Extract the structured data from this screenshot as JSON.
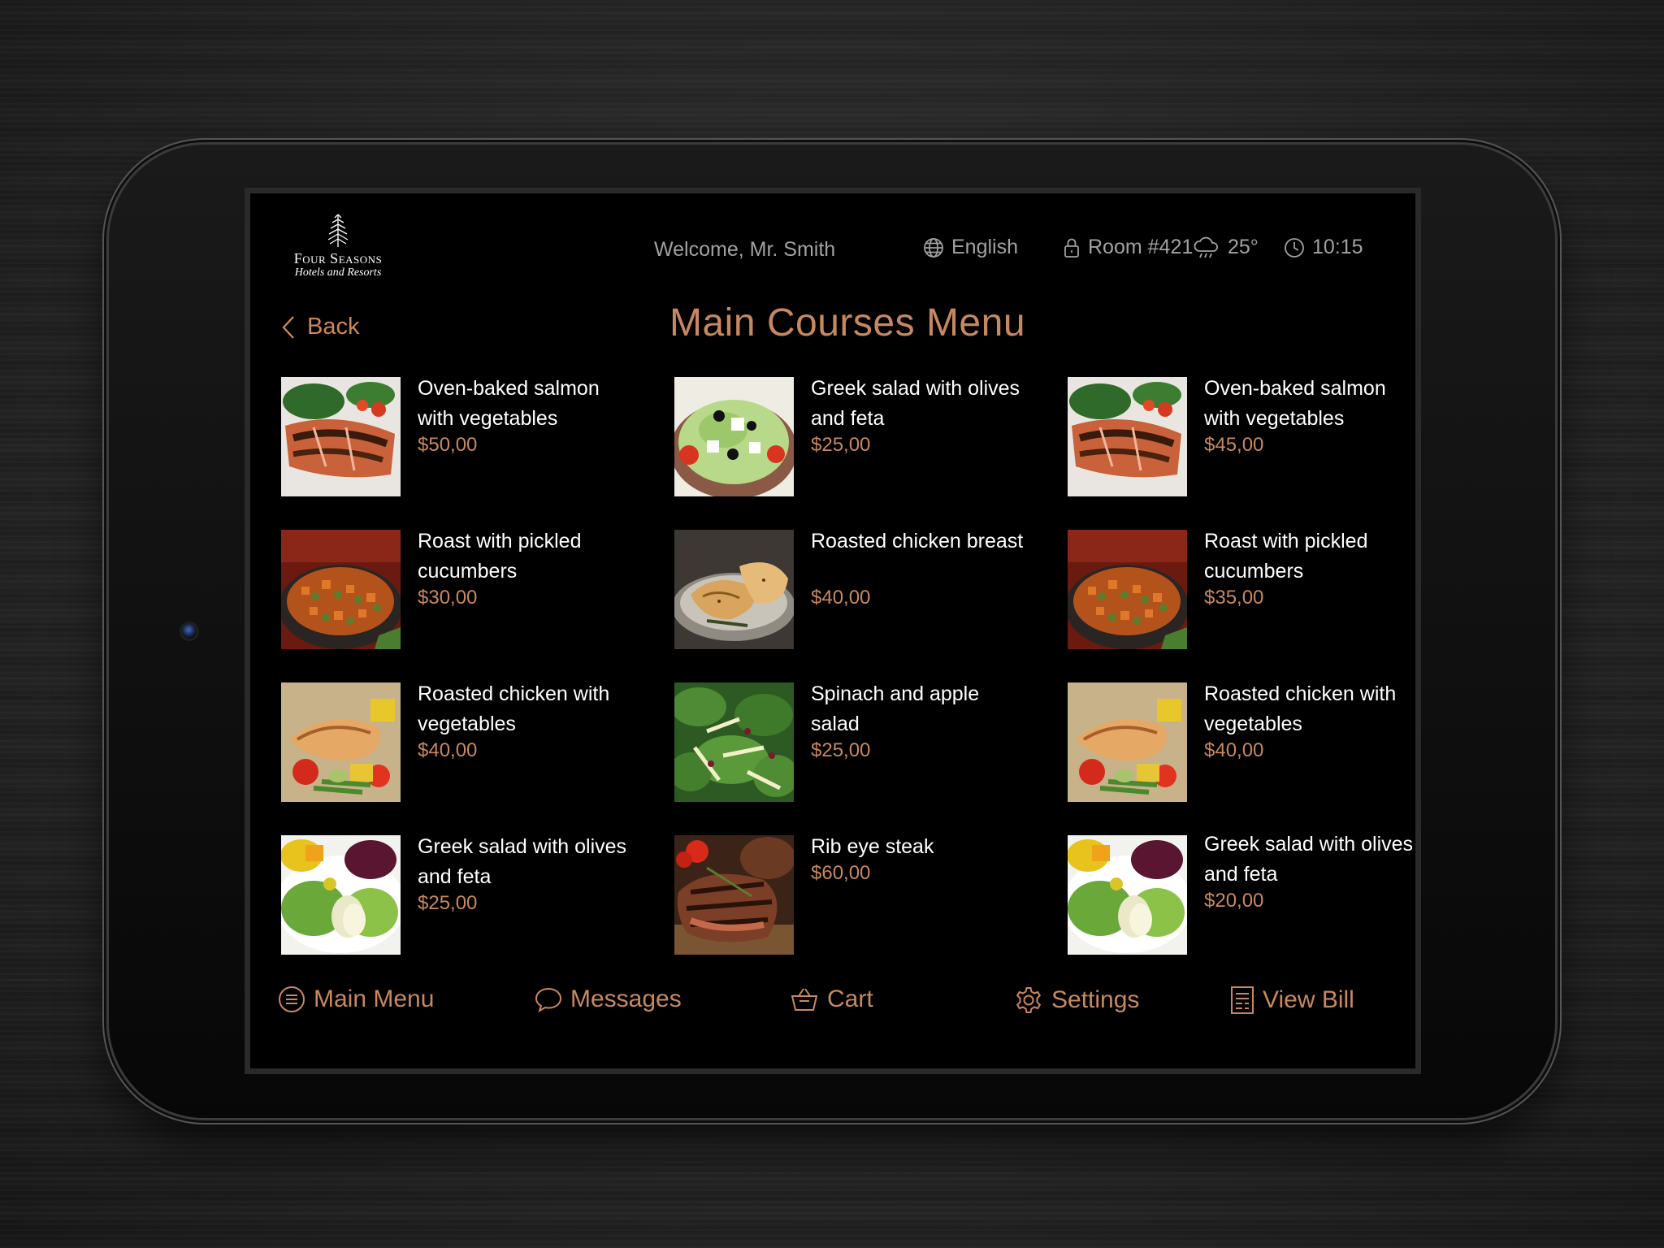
{
  "header": {
    "logo_brand": "Four Seasons",
    "logo_sub": "Hotels and Resorts",
    "welcome": "Welcome, Mr. Smith",
    "language": "English",
    "room": "Room #421",
    "temperature": "25°",
    "time": "10:15"
  },
  "back_label": "Back",
  "page_title": "Main Courses Menu",
  "menu_items": [
    {
      "name": "Oven-baked salmon with vegetables",
      "price": "$50,00",
      "image": "salmon"
    },
    {
      "name": "Greek salad with olives and feta",
      "price": "$25,00",
      "image": "greek-bowl"
    },
    {
      "name": "Oven-baked salmon with vegetables",
      "price": "$45,00",
      "image": "salmon"
    },
    {
      "name": "Roast with pickled cucumbers",
      "price": "$30,00",
      "image": "roast"
    },
    {
      "name": "Roasted chicken breast",
      "price": "$40,00",
      "image": "chicken-breast"
    },
    {
      "name": "Roast with pickled cucumbers",
      "price": "$35,00",
      "image": "roast"
    },
    {
      "name": "Roasted chicken with vegetables",
      "price": "$40,00",
      "image": "chicken-veg"
    },
    {
      "name": "Spinach and apple salad",
      "price": "$25,00",
      "image": "spinach"
    },
    {
      "name": "Roasted chicken with vegetables",
      "price": "$40,00",
      "image": "chicken-veg"
    },
    {
      "name": "Greek salad with olives and feta",
      "price": "$25,00",
      "image": "greek-plate"
    },
    {
      "name": "Rib eye steak",
      "price": "$60,00",
      "image": "steak"
    },
    {
      "name": "Greek salad with olives and feta",
      "price": "$20,00",
      "image": "greek-plate"
    }
  ],
  "bottom_nav": {
    "main_menu": "Main Menu",
    "messages": "Messages",
    "cart": "Cart",
    "settings": "Settings",
    "view_bill": "View Bill"
  },
  "colors": {
    "accent": "#c8885f",
    "muted_text": "#a1a1a1",
    "screen_bg": "#000000"
  },
  "icons": {
    "language": "globe-icon",
    "room": "lock-icon",
    "weather": "rain-cloud-icon",
    "time": "clock-icon",
    "back": "chevron-left-icon",
    "main_menu": "menu-circle-icon",
    "messages": "speech-bubble-icon",
    "cart": "basket-icon",
    "settings": "gear-icon",
    "view_bill": "receipt-icon"
  }
}
